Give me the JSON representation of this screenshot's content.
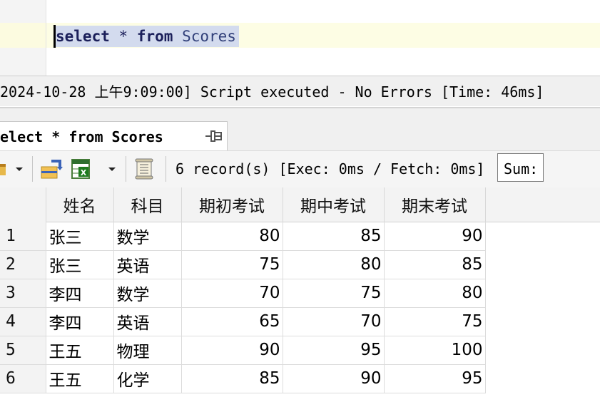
{
  "editor": {
    "query_keyword_select": "select",
    "query_star": "*",
    "query_keyword_from": "from",
    "query_table": "Scores"
  },
  "messages": {
    "log_line": "2024-10-28 上午9:09:00] Script executed - No Errors [Time: 46ms]"
  },
  "result_tab": {
    "label": "elect * from Scores",
    "pin_icon": "pin-icon"
  },
  "toolbar": {
    "status": "6 record(s) [Exec: 0ms / Fetch: 0ms]",
    "sum_label": "Sum:",
    "icons": [
      "grid-edit-icon",
      "dropdown-arrow-icon",
      "table-export-icon",
      "excel-export-icon",
      "dropdown-arrow-icon",
      "script-icon"
    ]
  },
  "grid": {
    "columns": [
      "姓名",
      "科目",
      "期初考试",
      "期中考试",
      "期末考试"
    ],
    "rows": [
      {
        "n": "1",
        "name": "张三",
        "subject": "数学",
        "start": "80",
        "mid": "85",
        "final": "90"
      },
      {
        "n": "2",
        "name": "张三",
        "subject": "英语",
        "start": "75",
        "mid": "80",
        "final": "85"
      },
      {
        "n": "3",
        "name": "李四",
        "subject": "数学",
        "start": "70",
        "mid": "75",
        "final": "80"
      },
      {
        "n": "4",
        "name": "李四",
        "subject": "英语",
        "start": "65",
        "mid": "70",
        "final": "75"
      },
      {
        "n": "5",
        "name": "王五",
        "subject": "物理",
        "start": "90",
        "mid": "95",
        "final": "100"
      },
      {
        "n": "6",
        "name": "王五",
        "subject": "化学",
        "start": "85",
        "mid": "90",
        "final": "95"
      }
    ]
  },
  "colors": {
    "selection": "#d3dbee",
    "current_line": "#fdfde4",
    "panel_bg": "#f0f0f0"
  }
}
